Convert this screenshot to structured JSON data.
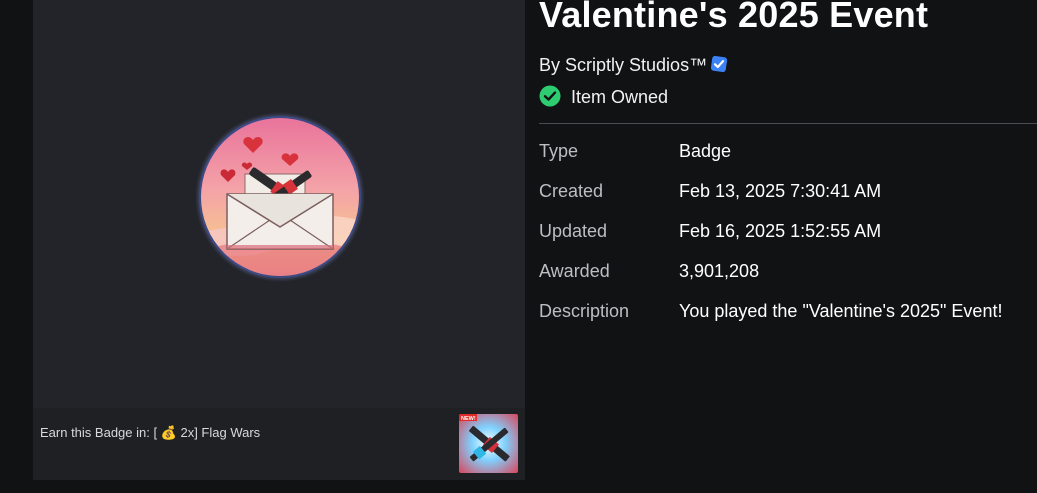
{
  "badge": {
    "title": "Valentine's 2025 Event",
    "creator_prefix": "By ",
    "creator_name": "Scriptly Studios™",
    "owned_label": "Item Owned"
  },
  "details": [
    {
      "label": "Type",
      "value": "Badge"
    },
    {
      "label": "Created",
      "value": "Feb 13, 2025 7:30:41 AM"
    },
    {
      "label": "Updated",
      "value": "Feb 16, 2025 1:52:55 AM"
    },
    {
      "label": "Awarded",
      "value": "3,901,208"
    },
    {
      "label": "Description",
      "value": "You played the \"Valentine's 2025\" Event!"
    }
  ],
  "earn": {
    "text": "Earn this Badge in: [ 💰 2x] Flag Wars",
    "thumb_tag": "NEW!"
  },
  "icons": {
    "badge_image": "valentine-envelope-badge-icon",
    "verified": "verified-check-icon",
    "owned": "check-circle-icon",
    "game_thumbnail": "flag-wars-thumbnail-icon"
  },
  "colors": {
    "verified_blue": "#3b82f6",
    "owned_green": "#2ecc71",
    "panel_bg": "#232429",
    "page_bg": "#111214"
  }
}
